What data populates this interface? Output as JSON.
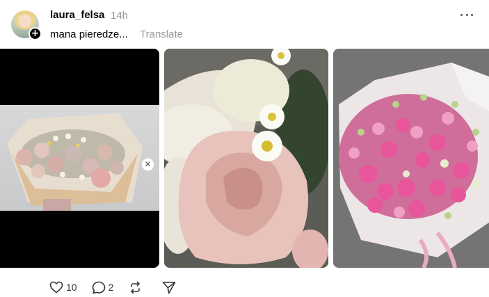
{
  "post": {
    "username": "laura_felsa",
    "time": "14h",
    "caption": "mana pieredze...",
    "translate_label": "Translate"
  },
  "actions": {
    "likes": "10",
    "comments": "2"
  },
  "icons": {
    "follow": "plus-icon",
    "more": "more-horizontal-icon",
    "close": "close-icon",
    "like": "heart-icon",
    "comment": "comment-icon",
    "repost": "repost-icon",
    "share": "send-icon"
  }
}
